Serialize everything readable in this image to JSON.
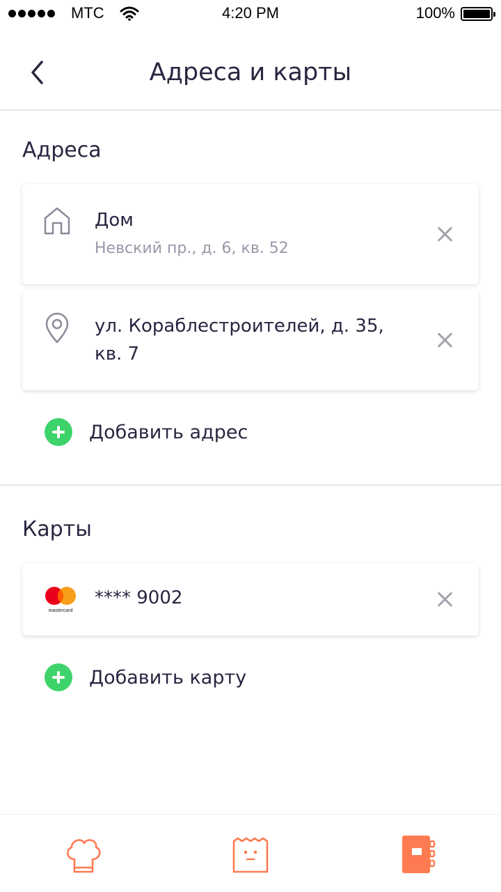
{
  "status_bar": {
    "carrier": "МТС",
    "time": "4:20 PM",
    "battery": "100%"
  },
  "nav": {
    "title": "Адреса и карты",
    "back_icon": "chevron-left-icon"
  },
  "addresses": {
    "section_title": "Адреса",
    "items": [
      {
        "icon": "home-icon",
        "title": "Дом",
        "subtitle": "Невский пр., д. 6, кв. 52"
      },
      {
        "icon": "location-pin-icon",
        "title_line1": "ул. Кораблестроителей, д. 35,",
        "title_line2": "кв. 7"
      }
    ],
    "add_label": "Добавить адрес"
  },
  "cards": {
    "section_title": "Карты",
    "items": [
      {
        "icon": "mastercard-icon",
        "brand": "mastercard",
        "number": "**** 9002"
      }
    ],
    "add_label": "Добавить карту"
  },
  "tab_bar": {
    "items": [
      {
        "icon": "chef-hat-icon"
      },
      {
        "icon": "shopping-bag-icon"
      },
      {
        "icon": "notebook-icon"
      }
    ]
  },
  "colors": {
    "accent": "#fe7b52",
    "add_green": "#3ed36a",
    "text": "#2a2540",
    "secondary_text": "#9a97a8"
  }
}
